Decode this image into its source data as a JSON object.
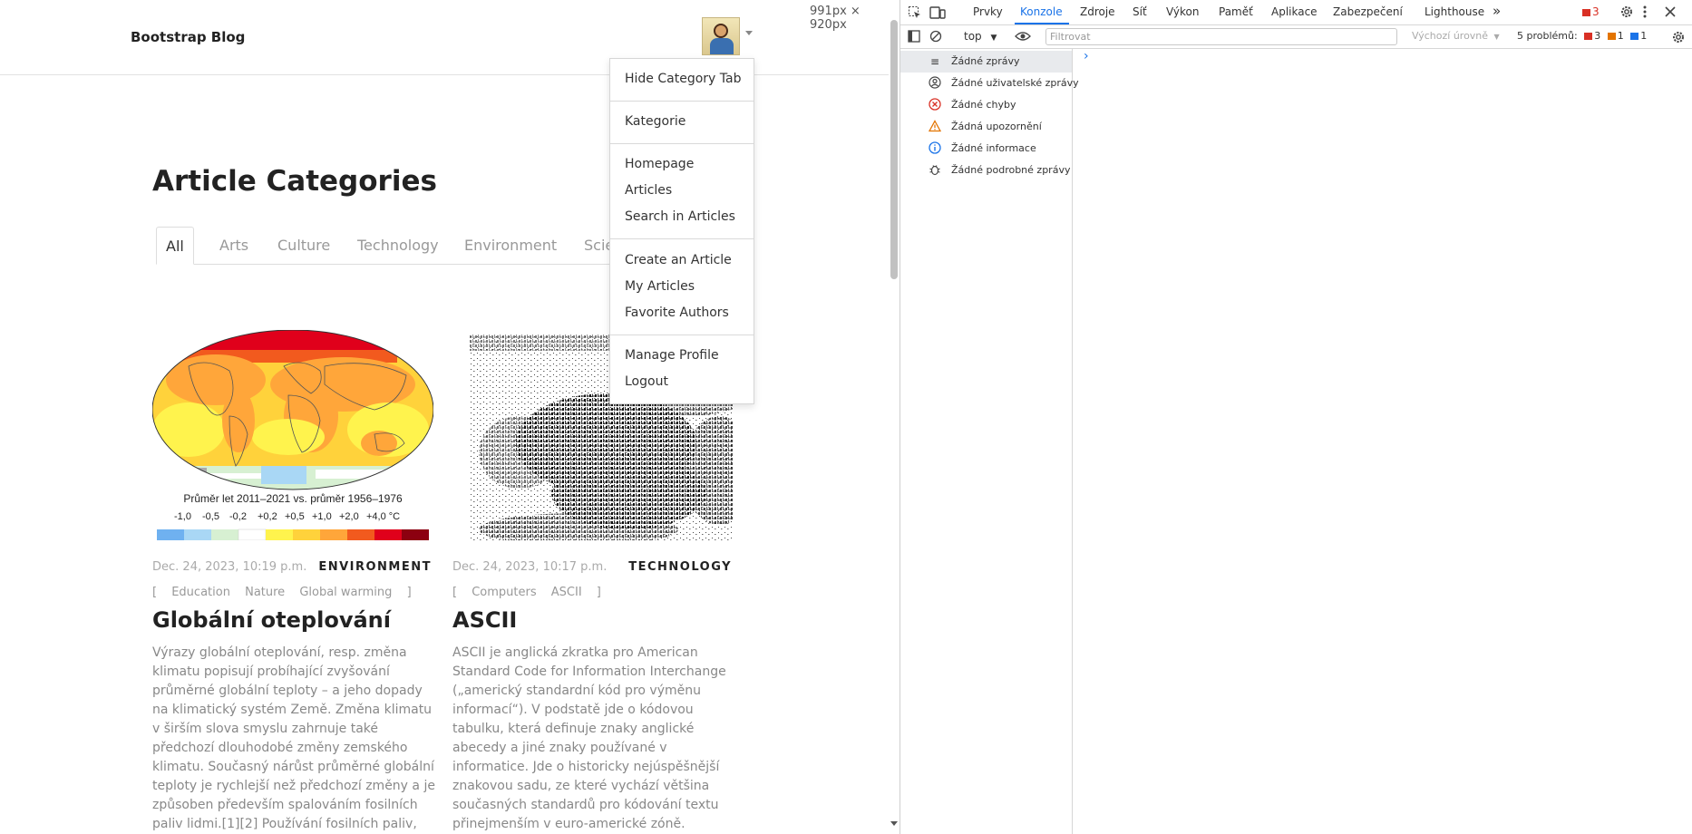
{
  "page": {
    "brand": "Bootstrap Blog",
    "size_indicator": "991px × 920px",
    "title": "Article Categories",
    "tabs": [
      {
        "label": "All"
      },
      {
        "label": "Arts"
      },
      {
        "label": "Culture"
      },
      {
        "label": "Technology"
      },
      {
        "label": "Environment"
      },
      {
        "label": "Scie"
      }
    ],
    "dropdown": {
      "items": [
        {
          "label": "Hide Category Tab"
        },
        {
          "label": "Kategorie"
        },
        {
          "label": "Homepage"
        },
        {
          "label": "Articles"
        },
        {
          "label": "Search in Articles"
        },
        {
          "label": "Create an Article"
        },
        {
          "label": "My Articles"
        },
        {
          "label": "Favorite Authors"
        },
        {
          "label": "Manage Profile"
        },
        {
          "label": "Logout"
        }
      ]
    },
    "articles": [
      {
        "date": "Dec. 24, 2023, 10:19 p.m.",
        "category": "ENVIRONMENT",
        "tag_open": "[",
        "tags": [
          "Education",
          "Nature",
          "Global warming"
        ],
        "tag_close": "]",
        "title": "Globální oteplování",
        "excerpt": "Výrazy globální oteplování, resp. změna klimatu popisují probíhající zvyšování průměrné globální teploty – a jeho dopady na klimatický systém Země. Změna klimatu v širším slova smyslu zahrnuje také předchozí dlouhodobé změny zemského klimatu. Současný nárůst průměrné globální teploty je rychlejší než předchozí změny a je způsoben především spalováním fosilních paliv lidmi.[1][2] Používání fosilních paliv, odlesňování a",
        "image": {
          "caption": "Průměr let 2011–2021 vs. průměr 1956–1976",
          "legend_ticks": [
            "-1,0",
            "-0,5",
            "-0,2",
            "+0,2",
            "+0,5",
            "+1,0",
            "+2,0",
            "+4,0 °C"
          ],
          "legend_colors": [
            "#6fb1f0",
            "#a9d7f5",
            "#d7f0d2",
            "#ffffff",
            "#fff34d",
            "#ffd23b",
            "#ffa63a",
            "#f25a1e",
            "#e0001b",
            "#8c0010"
          ]
        }
      },
      {
        "date": "Dec. 24, 2023, 10:17 p.m.",
        "category": "TECHNOLOGY",
        "tag_open": "[",
        "tags": [
          "Computers",
          "ASCII"
        ],
        "tag_close": "]",
        "title": "ASCII",
        "excerpt": "ASCII je anglická zkratka pro American Standard Code for Information Interchange („americký standardní kód pro výměnu informací“). V podstatě jde o kódovou tabulku, která definuje znaky anglické abecedy a jiné znaky používané v informatice. Jde o historicky nejúspěšnější znakovou sadu, ze které vychází většina současných standardů pro kódování textu přinejmenším v euro-americké zóně. Tabulka obsahuje tisknutelné znaky: písmena,"
      }
    ]
  },
  "devtools": {
    "tabs": [
      {
        "label": "Prvky"
      },
      {
        "label": "Konzole"
      },
      {
        "label": "Zdroje"
      },
      {
        "label": "Síť"
      },
      {
        "label": "Výkon"
      },
      {
        "label": "Paměť"
      },
      {
        "label": "Aplikace"
      },
      {
        "label": "Zabezpečení"
      },
      {
        "label": "Lighthouse"
      }
    ],
    "active_tab": "Konzole",
    "more_tabs": "»",
    "error_count": "3",
    "context": "top",
    "filter_placeholder": "Filtrovat",
    "levels": "Výchozí úrovně",
    "problems_label": "5 problémů:",
    "problems": {
      "errors": "3",
      "warnings": "1",
      "info": "1"
    },
    "sidebar": [
      {
        "label": "Žádné zprávy",
        "icon": "list-icon"
      },
      {
        "label": "Žádné uživatelské zprávy",
        "icon": "user-icon"
      },
      {
        "label": "Žádné chyby",
        "icon": "error-icon"
      },
      {
        "label": "Žádná upozornění",
        "icon": "warning-icon"
      },
      {
        "label": "Žádné informace",
        "icon": "info-icon"
      },
      {
        "label": "Žádné podrobné zprávy",
        "icon": "bug-icon"
      }
    ],
    "prompt": "›"
  }
}
